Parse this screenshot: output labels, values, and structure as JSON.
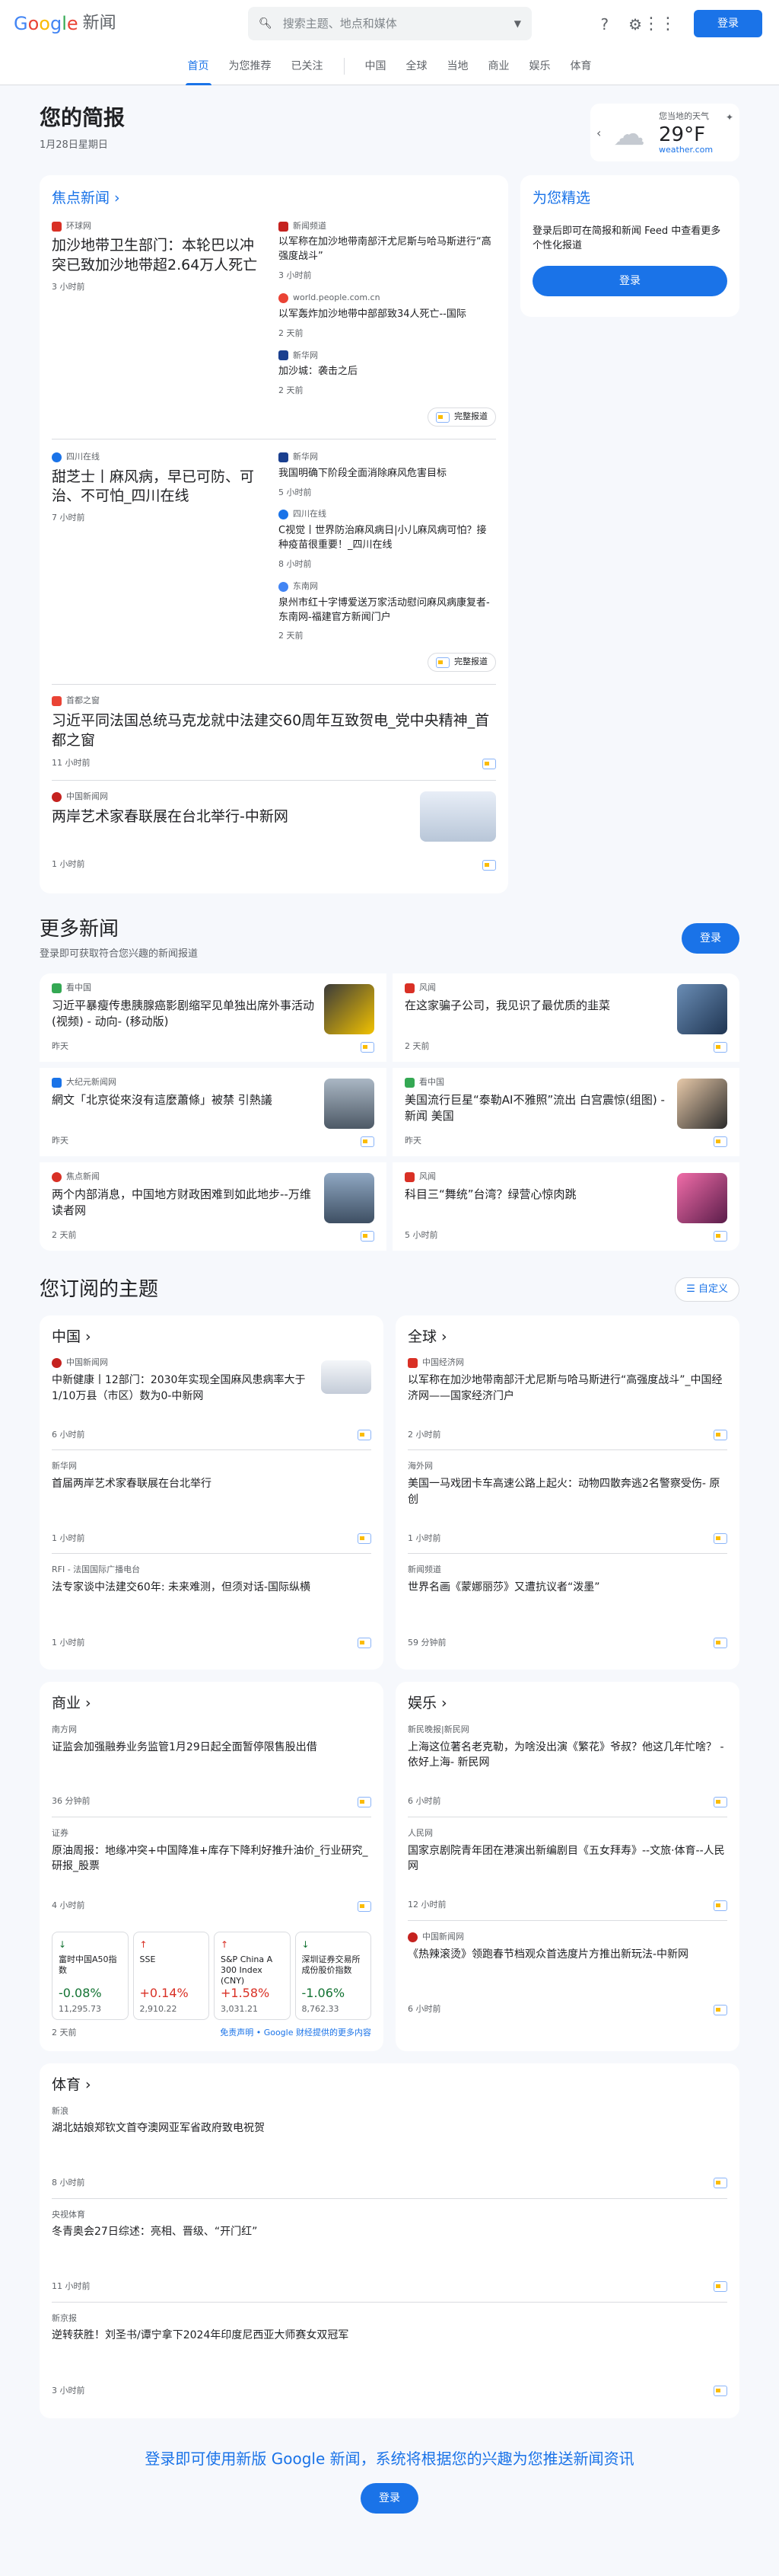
{
  "header": {
    "logo_word": "新闻",
    "search_placeholder": "搜索主题、地点和媒体",
    "sign_in": "登录"
  },
  "nav": [
    "首页",
    "为您推荐",
    "已关注",
    "中国",
    "全球",
    "当地",
    "商业",
    "娱乐",
    "体育"
  ],
  "briefing": {
    "title": "您的简报",
    "date": "1月28日星期日"
  },
  "weather": {
    "location": "您当地的天气",
    "temp": "29°F",
    "source": "weather.com"
  },
  "top": {
    "title": "焦点新闻",
    "full_coverage": "完整报道",
    "stories": [
      {
        "main": {
          "source": "环球网",
          "headline": "加沙地带卫生部门：本轮巴以冲突已致加沙地带超2.64万人死亡",
          "time": "3 小时前"
        },
        "subs": [
          {
            "source": "新闻频道",
            "headline": "以军称在加沙地带南部汗尤尼斯与哈马斯进行“高强度战斗”",
            "time": "3 小时前"
          },
          {
            "source": "world.people.com.cn",
            "headline": "以军轰炸加沙地带中部部致34人死亡--国际",
            "time": "2 天前"
          },
          {
            "source": "新华网",
            "headline": "加沙城：袭击之后",
            "time": "2 天前"
          }
        ]
      },
      {
        "main": {
          "source": "四川在线",
          "headline": "甜芝士丨麻风病，早已可防、可治、不可怕_四川在线",
          "time": "7 小时前"
        },
        "subs": [
          {
            "source": "新华网",
            "headline": "我国明确下阶段全面消除麻风危害目标",
            "time": "5 小时前"
          },
          {
            "source": "四川在线",
            "headline": "C视觉丨世界防治麻风病日|小儿麻风病可怕？接种疫苗很重要！_四川在线",
            "time": "8 小时前"
          },
          {
            "source": "东南网",
            "headline": "泉州市红十字博爱送万家活动慰问麻风病康复者-东南网-福建官方新闻门户",
            "time": "2 天前"
          }
        ]
      }
    ],
    "wide": [
      {
        "source": "首都之窗",
        "headline": "习近平同法国总统马克龙就中法建交60周年互致贺电_党中央精神_首都之窗",
        "time": "11 小时前"
      },
      {
        "source": "中国新闻网",
        "headline": "两岸艺术家春联展在台北举行-中新网",
        "time": "1 小时前"
      }
    ]
  },
  "picks": {
    "title": "为您精选",
    "desc": "登录后即可在简报和新闻 Feed 中查看更多个性化报道",
    "sign_in": "登录"
  },
  "more": {
    "title": "更多新闻",
    "subtitle": "登录即可获取符合您兴趣的新闻报道",
    "sign_in": "登录",
    "items": [
      {
        "source": "看中国",
        "headline": "习近平暴瘦传患胰腺癌影剧缩罕见单独出席外事活动(视频) - 动向- (移动版)",
        "time": "昨天"
      },
      {
        "source": "风闻",
        "headline": "在这家骗子公司，我见识了最优质的韭菜",
        "time": "2 天前"
      },
      {
        "source": "大纪元新闻网",
        "headline": "網文「北京從來沒有這麼蕭條」被禁 引熱議",
        "time": "昨天"
      },
      {
        "source": "看中国",
        "headline": "美国流行巨星“泰勒AI不雅照”流出 白宫震惊(组图) - 新闻 美国",
        "time": "昨天"
      },
      {
        "source": "焦点新闻",
        "headline": "两个内部消息，中国地方财政困难到如此地步--万维读者网",
        "time": "2 天前"
      },
      {
        "source": "风闻",
        "headline": "科目三“舞统”台湾？绿营心惊肉跳",
        "time": "5 小时前"
      }
    ]
  },
  "subscribed": {
    "title": "您订阅的主题",
    "customize": "自定义",
    "topics": [
      {
        "title": "中国",
        "items": [
          {
            "source": "中国新闻网",
            "headline": "中新健康丨12部门：2030年实现全国麻风患病率大于1/10万县（市区）数为0-中新网",
            "time": "6 小时前"
          },
          {
            "source": "新华网",
            "headline": "首届两岸艺术家春联展在台北举行",
            "time": "1 小时前"
          },
          {
            "source": "RFI - 法国国际广播电台",
            "headline": "法专家谈中法建交60年: 未来难测，但须对话-国际纵横",
            "time": "1 小时前"
          }
        ]
      },
      {
        "title": "全球",
        "items": [
          {
            "source": "中国经济网",
            "headline": "以军称在加沙地带南部汗尤尼斯与哈马斯进行“高强度战斗”_中国经济网——国家经济门户",
            "time": "2 小时前"
          },
          {
            "source": "海外网",
            "headline": "美国一马戏团卡车高速公路上起火：动物四散奔逃2名警察受伤- 原创",
            "time": "1 小时前"
          },
          {
            "source": "新闻频道",
            "headline": "世界名画《蒙娜丽莎》又遭抗议者“泼墨”",
            "time": "59 分钟前"
          }
        ]
      },
      {
        "title": "商业",
        "items": [
          {
            "source": "南方网",
            "headline": "证监会加强融券业务监管1月29日起全面暂停限售股出借",
            "time": "36 分钟前"
          },
          {
            "source": "证券",
            "headline": "原油周报：地缘冲突+中国降准+库存下降利好推升油价_行业研究_研报_股票",
            "time": "4 小时前"
          }
        ]
      },
      {
        "title": "娱乐",
        "items": [
          {
            "source": "新民晚报|新民网",
            "headline": "上海这位著名老克勒，为啥没出演《繁花》爷叔？他这几年忙啥？ - 依好上海- 新民网",
            "time": "6 小时前"
          },
          {
            "source": "人民网",
            "headline": "国家京剧院青年团在港演出新编剧目《五女拜寿》--文旅·体育--人民网",
            "time": "12 小时前"
          },
          {
            "source": "中国新闻网",
            "headline": "《热辣滚烫》领跑春节档观众首选度片方推出新玩法-中新网",
            "time": "6 小时前"
          }
        ]
      }
    ],
    "stocks": [
      {
        "name": "富时中国A50指数",
        "pct": "-0.08%",
        "value": "11,295.73"
      },
      {
        "name": "SSE",
        "pct": "+0.14%",
        "value": "2,910.22"
      },
      {
        "name": "S&P China A 300 Index (CNY)",
        "pct": "+1.58%",
        "value": "3,031.21"
      },
      {
        "name": "深圳证券交易所成份股价指数",
        "pct": "-1.06%",
        "value": "8,762.33"
      }
    ],
    "stocks_time": "2 天前",
    "disclaimer": "免责声明 • Google 财经提供的更多内容",
    "sports": {
      "title": "体育",
      "items": [
        {
          "source": "新浪",
          "headline": "湖北姑娘郑钦文首夺澳网亚军省政府致电祝贺",
          "time": "8 小时前"
        },
        {
          "source": "央视体育",
          "headline": "冬青奥会27日综述：亮相、晋级、“开门红”",
          "time": "11 小时前"
        },
        {
          "source": "新京报",
          "headline": "逆转获胜！刘圣书/谭宁拿下2024年印度尼西亚大师赛女双冠军",
          "time": "3 小时前"
        }
      ]
    }
  },
  "footer": {
    "message": "登录即可使用新版 Google 新闻，系统将根据您的兴趣为您推送新闻资讯",
    "sign_in": "登录"
  },
  "colors": {
    "accent": "#1a73e8",
    "up": "#d93025",
    "down": "#137333",
    "bg": "#f6f8fc"
  }
}
